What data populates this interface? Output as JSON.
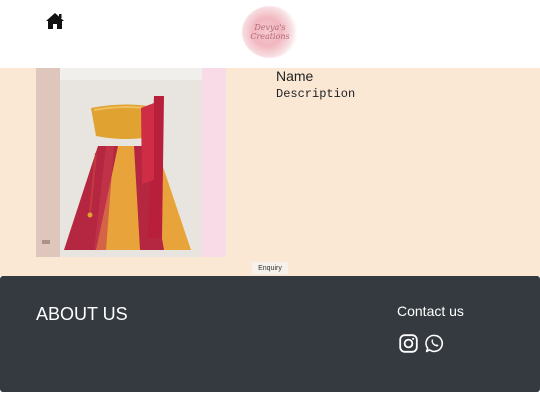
{
  "header": {
    "home_icon": "home-icon",
    "logo_text_line1": "Devya's",
    "logo_text_line2": "Creations"
  },
  "product": {
    "name": "Name",
    "description": "Description",
    "enquiry_label": "Enquiry"
  },
  "footer": {
    "about_heading": "ABOUT US",
    "contact_heading": "Contact us",
    "social_icons": [
      "instagram-icon",
      "whatsapp-icon"
    ]
  },
  "colors": {
    "content_background": "#fae8d4",
    "footer_background": "#343a40",
    "header_background": "#ffffff"
  }
}
